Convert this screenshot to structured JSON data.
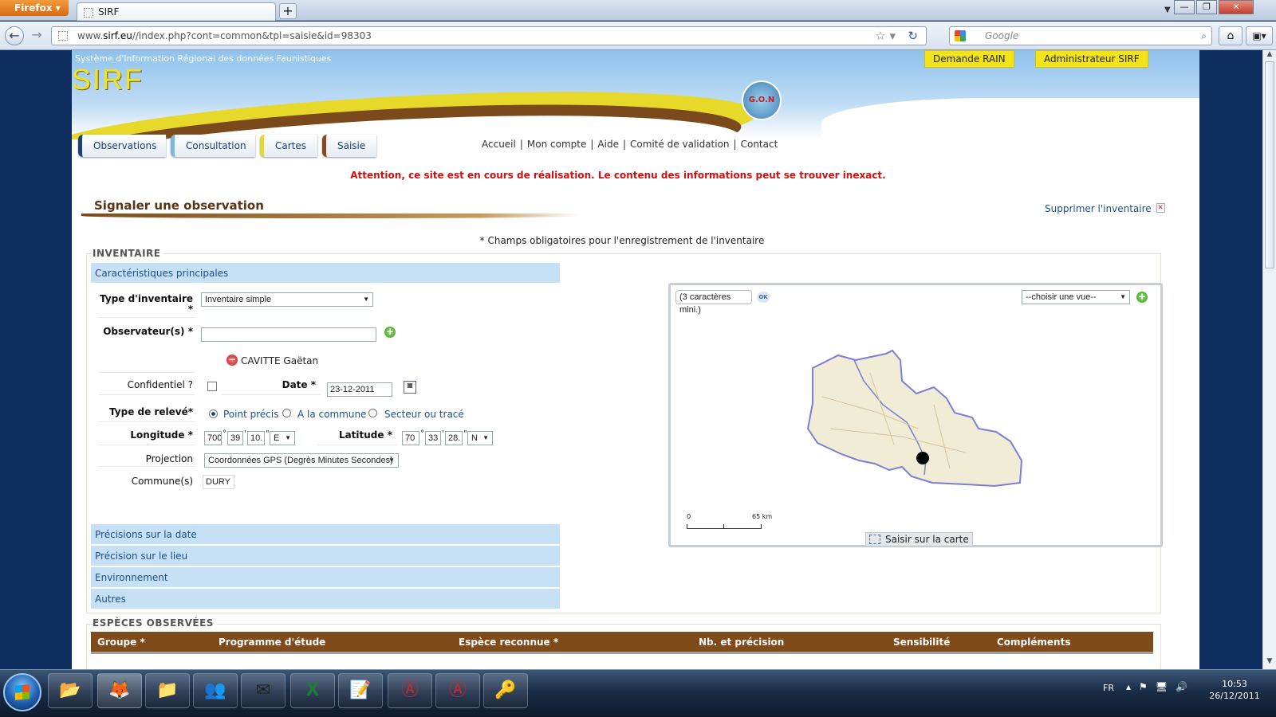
{
  "browser": {
    "menu_button": "Firefox",
    "tab_title": "SIRF",
    "new_tab": "+",
    "url_prefix": "www.",
    "url_host": "sirf.eu",
    "url_path": "//index.php?cont=common&tpl=saisie&id=98303",
    "search_placeholder": "Google"
  },
  "site": {
    "subtitle": "Système d'Information Régional des données Faunistiques",
    "logo": "SIRF",
    "partner_logo": "G.O.N",
    "top_buttons": [
      "Demande RAIN",
      "Administrateur SIRF"
    ],
    "tabs": [
      "Observations",
      "Consultation",
      "Cartes",
      "Saisie"
    ],
    "links": [
      "Accueil",
      "Mon compte",
      "Aide",
      "Comité de validation",
      "Contact"
    ],
    "warning": "Attention, ce site est en cours de réalisation. Le contenu des informations peut se trouver inexact."
  },
  "form": {
    "title": "Signaler une observation",
    "delete_link": "Supprimer l'inventaire",
    "required_note": "* Champs obligatoires pour l'enregistrement de l'inventaire",
    "inventory_legend": "INVENTAIRE",
    "main_section": "Caractéristiques principales",
    "type_label": "Type d'inventaire",
    "type_star": "*",
    "type_value": "Inventaire simple",
    "observers_label": "Observateur(s) *",
    "observers_value": "",
    "observer_name": "CAVITTE Gaëtan",
    "confidential_label": "Confidentiel ?",
    "date_label": "Date *",
    "date_value": "23-12-2011",
    "record_type_label": "Type de relevé*",
    "record_options": [
      "Point précis",
      "A la commune",
      "Secteur ou tracé"
    ],
    "record_selected": "Point précis",
    "longitude_label": "Longitude *",
    "longitude": {
      "deg": "700",
      "min": "39",
      "sec": "10.",
      "dir": "E"
    },
    "latitude_label": "Latitude *",
    "latitude": {
      "deg": "70",
      "min": "33",
      "sec": "28.",
      "dir": "N"
    },
    "projection_label": "Projection",
    "projection_value": "Coordonnées GPS (Degrès Minutes Secondes)",
    "commune_label": "Commune(s)",
    "commune_value": "DURY",
    "collapsed_sections": [
      "Précisions sur la date",
      "Précision sur le lieu",
      "Environnement",
      "Autres"
    ],
    "species_legend": "ESPÈCES OBSERVÉES",
    "species_columns": [
      "Groupe *",
      "Programme d'étude",
      "Espèce reconnue *",
      "Nb. et précision",
      "Sensibilité",
      "Compléments"
    ]
  },
  "map": {
    "search_placeholder": "(3 caractères mini.)",
    "ok_label": "OK",
    "view_select": "--choisir une vue--",
    "scale_start": "0",
    "scale_end": "65 km",
    "capture_button": "Saisir sur la carte"
  },
  "taskbar": {
    "language": "FR",
    "time": "10:53",
    "date": "26/12/2011"
  },
  "colors": {
    "accent_brown": "#7f4b1b",
    "section_blue": "#c6e0f6",
    "warning_red": "#d01010",
    "banner_yellow": "#f2e31a"
  }
}
